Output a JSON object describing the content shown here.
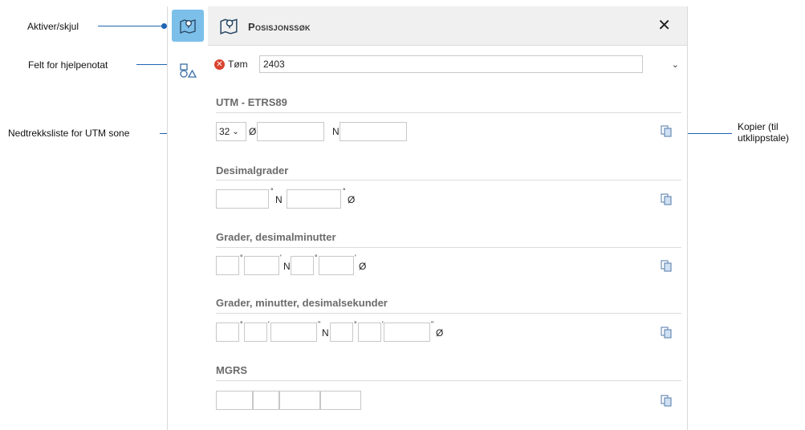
{
  "callouts": {
    "toggle": "Aktiver/skjul",
    "note": "Felt for hjelpenotat",
    "zone": "Nedtrekksliste for UTM sone",
    "copy": "Kopier (til utklippstale)"
  },
  "panel": {
    "title": "Posisjonssøk",
    "close": "✕",
    "clear_label": "Tøm",
    "note_value": "2403"
  },
  "utm": {
    "title": "UTM - ETRS89",
    "zone_value": "32",
    "east_label": "Ø",
    "north_label": "N"
  },
  "decimal": {
    "title": "Desimalgrader",
    "north_label": "N",
    "east_label": "Ø"
  },
  "ddm": {
    "title": "Grader, desimalminutter",
    "north_label": "N",
    "east_label": "Ø"
  },
  "dms": {
    "title": "Grader, minutter, desimalsekunder",
    "north_label": "N",
    "east_label": "Ø"
  },
  "mgrs": {
    "title": "MGRS"
  },
  "icons": {
    "toggle": "map-pin-icon",
    "shapes": "shapes-icon",
    "copy": "copy-icon",
    "clear": "close-circle-icon"
  },
  "colors": {
    "accent": "#1f64b4",
    "active": "#7cc0ea",
    "clear": "#d9432f"
  }
}
